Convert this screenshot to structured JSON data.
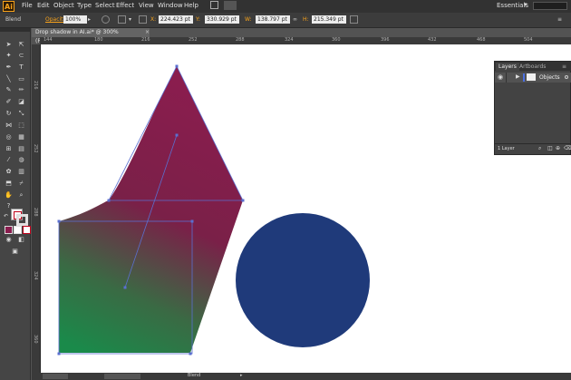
{
  "app": {
    "logo": "Ai"
  },
  "menubar": {
    "items": [
      "File",
      "Edit",
      "Object",
      "Type",
      "Select",
      "Effect",
      "View",
      "Window",
      "Help"
    ],
    "workspace": "Essentials"
  },
  "control_bar": {
    "mode": "Blend",
    "opacity_label": "Opacity:",
    "opacity_value": "100%",
    "x_label": "X:",
    "x_value": "224.423 pt",
    "y_label": "Y:",
    "y_value": "330.929 pt",
    "w_label": "W:",
    "w_value": "138.797 pt",
    "h_label": "H:",
    "h_value": "215.349 pt"
  },
  "document": {
    "tab_title": "Drop shadow in AI.ai* @ 300% (RGB/Preview)",
    "ruler_h_ticks": [
      "144",
      "180",
      "216",
      "252",
      "288",
      "324",
      "360",
      "396",
      "432",
      "468",
      "504"
    ],
    "ruler_v_ticks": [
      "216",
      "252",
      "288",
      "324",
      "360"
    ],
    "status_mode": "Blend"
  },
  "layers_panel": {
    "tabs": [
      "Layers",
      "Artboards"
    ],
    "layer_name": "Objects",
    "footer_count": "1 Layer"
  },
  "colors": {
    "pink_shape": "#8a1d4e",
    "green_shape": "#1a8a4a",
    "circle": "#1f3a7a",
    "selection": "#5a6fd0"
  }
}
